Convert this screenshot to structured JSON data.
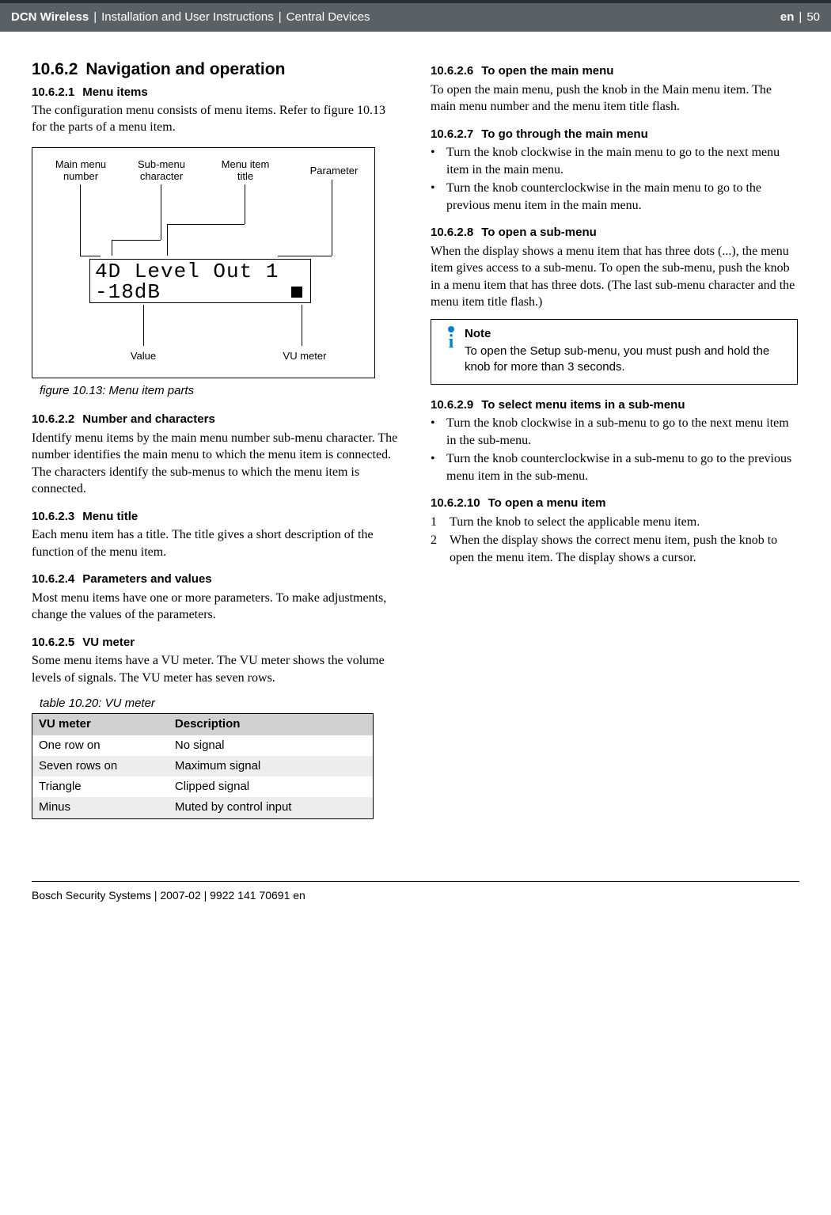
{
  "header": {
    "product": "DCN Wireless",
    "sep1": " | ",
    "doc": "Installation and User Instructions",
    "sep2": " | ",
    "chapter": "Central Devices",
    "lang": "en",
    "pagesep": " | ",
    "page": "50"
  },
  "left": {
    "h2": {
      "num": "10.6.2",
      "title": "Navigation and operation"
    },
    "s1": {
      "num": "10.6.2.1",
      "title": "Menu items",
      "p": "The configuration menu consists of menu items. Refer to figure 10.13 for the parts of a menu item."
    },
    "fig": {
      "labels": {
        "mmn": "Main menu\nnumber",
        "smc": "Sub-menu\ncharacter",
        "mit": "Menu item\ntitle",
        "param": "Parameter",
        "value": "Value",
        "vu": "VU meter"
      },
      "lcd_line1": "4D Level   Out 1",
      "lcd_line2": "-18dB",
      "caption": "figure 10.13: Menu item parts"
    },
    "s2": {
      "num": "10.6.2.2",
      "title": "Number and characters",
      "p": "Identify menu items by the main menu number sub-menu character. The number identifies the main menu to which the menu item is connected. The characters identify the sub-menus to which the menu item is connected."
    },
    "s3": {
      "num": "10.6.2.3",
      "title": "Menu title",
      "p": "Each menu item has a title. The title gives a short description of the function of the menu item."
    },
    "s4": {
      "num": "10.6.2.4",
      "title": "Parameters and values",
      "p": "Most menu items have one or more parameters. To make adjustments, change the values of the parameters."
    },
    "s5": {
      "num": "10.6.2.5",
      "title": "VU meter",
      "p": "Some menu items have a VU meter. The VU meter shows the volume levels of signals. The VU meter has seven rows."
    },
    "table": {
      "caption": "table 10.20: VU meter",
      "h1": "VU meter",
      "h2": "Description",
      "rows": [
        {
          "c1": "One row on",
          "c2": "No signal"
        },
        {
          "c1": "Seven rows on",
          "c2": "Maximum signal"
        },
        {
          "c1": "Triangle",
          "c2": "Clipped signal"
        },
        {
          "c1": "Minus",
          "c2": "Muted by control input"
        }
      ]
    }
  },
  "right": {
    "s6": {
      "num": "10.6.2.6",
      "title": "To open the main menu",
      "p": "To open the main menu, push the knob in the Main menu item. The main menu number and the menu item title flash."
    },
    "s7": {
      "num": "10.6.2.7",
      "title": "To go through the main menu",
      "b1": "Turn the knob clockwise in the main menu to go to the next menu item in the main menu.",
      "b2": "Turn the knob counterclockwise in the main menu to go to the previous menu item in the main menu."
    },
    "s8": {
      "num": "10.6.2.8",
      "title": "To open a sub-menu",
      "p": "When the display shows a menu item that has three dots (...), the menu item gives access to a sub-menu. To open the sub-menu, push the knob in a menu item that has three dots. (The last sub-menu character and the menu item title flash.)"
    },
    "note": {
      "title": "Note",
      "text": "To open the Setup sub-menu, you must push and hold the knob for more than 3 seconds."
    },
    "s9": {
      "num": "10.6.2.9",
      "title": "To select menu items in a sub-menu",
      "b1": "Turn the knob clockwise in a sub-menu to go to the next menu item in the sub-menu.",
      "b2": "Turn the knob counterclockwise in a sub-menu to go to the previous menu item in the sub-menu."
    },
    "s10": {
      "num": "10.6.2.10",
      "title": "To open a menu item",
      "n1": "Turn the knob to select the applicable menu item.",
      "n2": "When the display shows the correct menu item, push the knob to open the menu item. The display shows a cursor."
    }
  },
  "footer": "Bosch Security Systems | 2007-02 | 9922 141 70691 en"
}
